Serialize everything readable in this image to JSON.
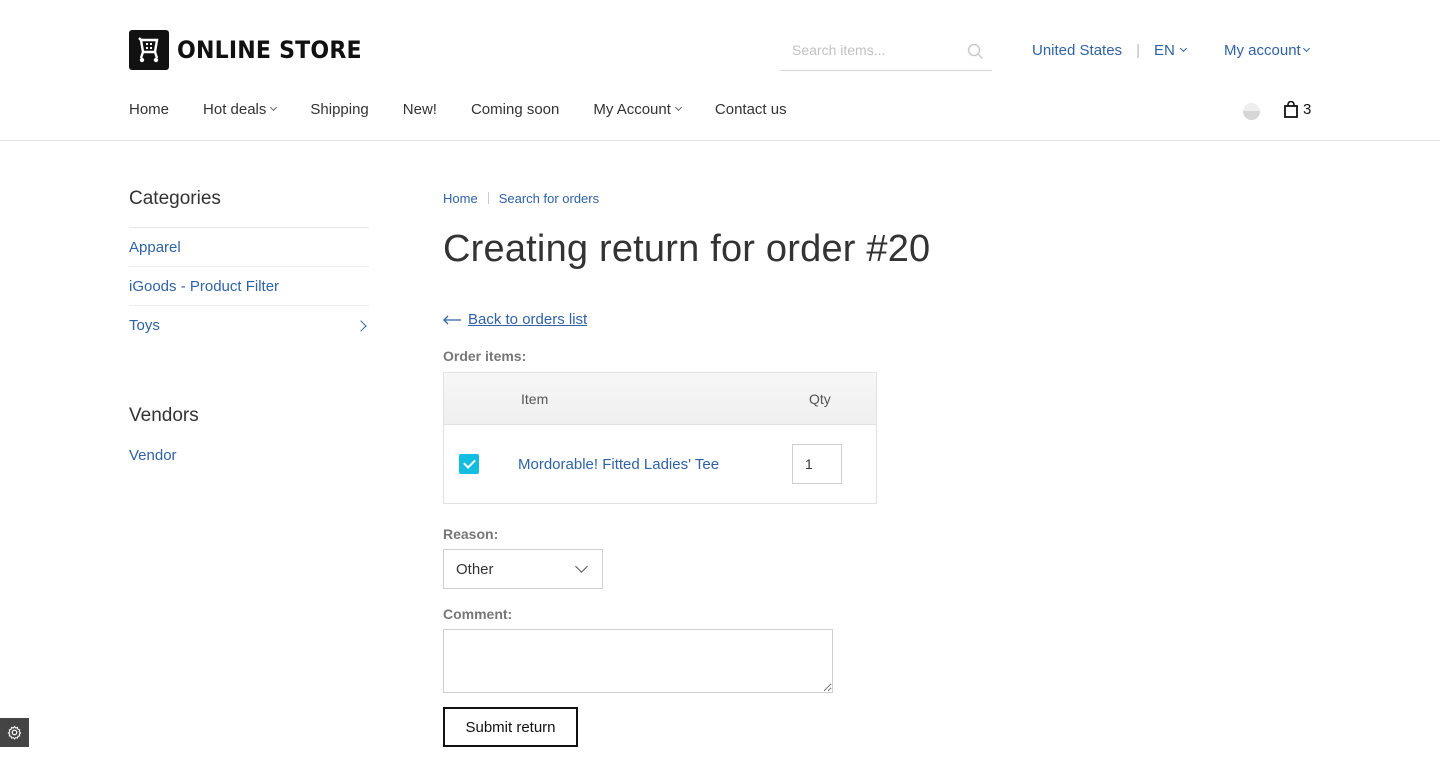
{
  "header": {
    "logo_text": "ONLINE STORE",
    "search_placeholder": "Search items...",
    "country": "United States",
    "language": "EN",
    "account": "My account",
    "cart_count": "3"
  },
  "nav": [
    {
      "label": "Home",
      "dropdown": false
    },
    {
      "label": "Hot deals",
      "dropdown": true
    },
    {
      "label": "Shipping",
      "dropdown": false
    },
    {
      "label": "New!",
      "dropdown": false
    },
    {
      "label": "Coming soon",
      "dropdown": false
    },
    {
      "label": "My Account",
      "dropdown": true
    },
    {
      "label": "Contact us",
      "dropdown": false
    }
  ],
  "sidebar": {
    "categories_title": "Categories",
    "categories": [
      {
        "label": "Apparel"
      },
      {
        "label": "iGoods - Product Filter"
      },
      {
        "label": "Toys"
      }
    ],
    "vendors_title": "Vendors",
    "vendors": [
      {
        "label": "Vendor"
      }
    ]
  },
  "main": {
    "breadcrumb": [
      "Home",
      "Search for orders"
    ],
    "title": "Creating return for order #20",
    "back_link": "Back to orders list",
    "order_items_label": "Order items:",
    "table": {
      "col_item": "Item",
      "col_qty": "Qty",
      "rows": [
        {
          "name": "Mordorable! Fitted Ladies' Tee",
          "qty": "1",
          "checked": true
        }
      ]
    },
    "reason_label": "Reason:",
    "reason_value": "Other",
    "comment_label": "Comment:",
    "submit_label": "Submit return"
  },
  "colors": {
    "link": "#2f62a6",
    "checkbox": "#13bde0"
  }
}
